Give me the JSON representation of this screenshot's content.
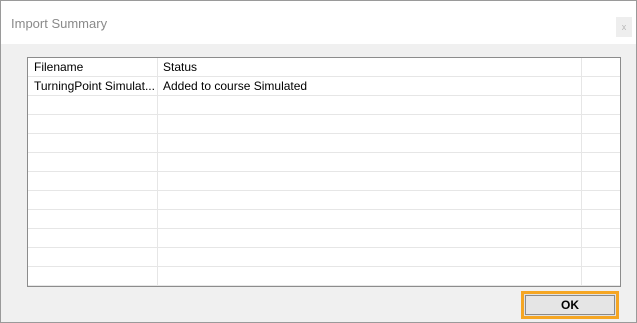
{
  "dialog": {
    "title": "Import Summary",
    "close_label": "x"
  },
  "table": {
    "columns": [
      "Filename",
      "Status"
    ],
    "rows": [
      [
        "TurningPoint Simulat...",
        "Added to course Simulated"
      ]
    ]
  },
  "buttons": {
    "ok_label": "OK"
  },
  "colors": {
    "highlight_border": "#f5a623",
    "dialog_background": "#f0f0f0"
  }
}
